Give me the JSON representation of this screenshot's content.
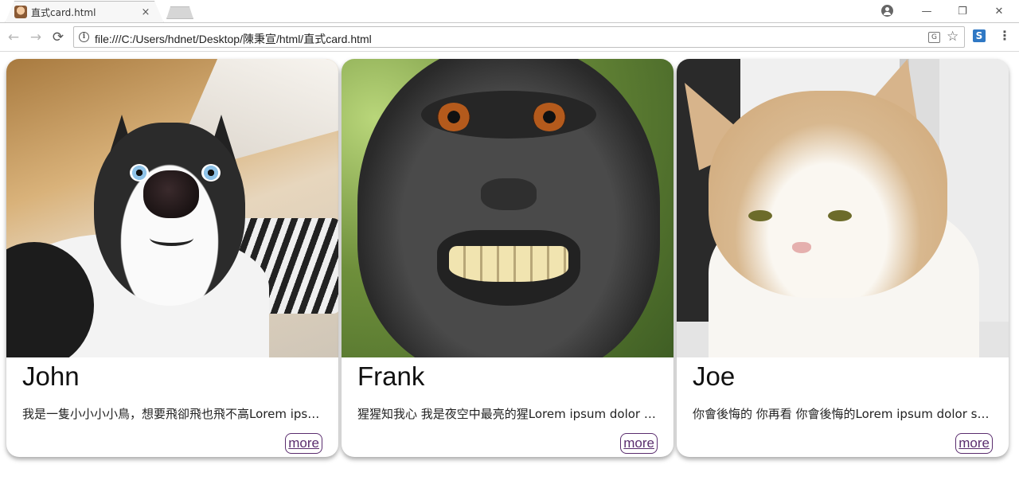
{
  "browser": {
    "tab_title": "直式card.html",
    "tab_close": "×",
    "url": "file:///C:/Users/hdnet/Desktop/陳秉宣/html/直式card.html",
    "back_glyph": "←",
    "forward_glyph": "→",
    "reload_glyph": "⟳",
    "info_glyph": "i",
    "star_glyph": "☆",
    "translate_glyph": "G",
    "extension_glyph": "S",
    "menu_glyph": "⋮",
    "minimize_glyph": "—",
    "restore_glyph": "❐",
    "close_glyph": "✕"
  },
  "cards": [
    {
      "name": "John",
      "text": "我是一隻小小小小鳥，想要飛卻飛也飛不高Lorem ipsum dolor sit amet",
      "more_label": "more",
      "image": "husky-photo"
    },
    {
      "name": "Frank",
      "text": "猩猩知我心 我是夜空中最亮的猩Lorem ipsum dolor sit amet",
      "more_label": "more",
      "image": "monkey-photo"
    },
    {
      "name": "Joe",
      "text": "你會後悔的 你再看 你會後悔的Lorem ipsum dolor sit amet",
      "more_label": "more",
      "image": "cat-photo"
    }
  ],
  "colors": {
    "more_border": "#5a2d6e",
    "card_shadow": "rgba(0,0,0,0.35)"
  }
}
